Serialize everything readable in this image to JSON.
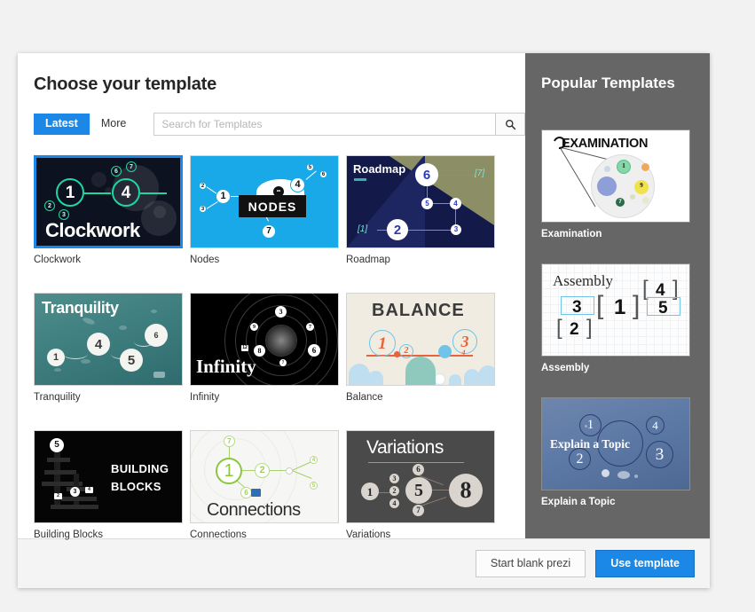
{
  "dialog": {
    "title": "Choose your template"
  },
  "filters": {
    "tabs": [
      {
        "label": "Latest",
        "active": true
      },
      {
        "label": "More",
        "active": false
      }
    ],
    "search": {
      "value": "",
      "placeholder": "Search for Templates",
      "icon": "search-icon"
    }
  },
  "templates": [
    {
      "label": "Clockwork",
      "selected": true,
      "numbers": [
        "1",
        "4",
        "2",
        "3",
        "6",
        "7"
      ],
      "title_text": "Clockwork"
    },
    {
      "label": "Nodes",
      "selected": false,
      "numbers": [
        "1",
        "2",
        "3",
        "4",
        "5",
        "6",
        "7"
      ],
      "title_text": "NODES"
    },
    {
      "label": "Roadmap",
      "selected": false,
      "numbers": [
        "1",
        "2",
        "3",
        "4",
        "5",
        "6",
        "7"
      ],
      "title_text": "Roadmap"
    },
    {
      "label": "Tranquility",
      "selected": false,
      "numbers": [
        "1",
        "4",
        "5",
        "6"
      ],
      "title_text": "Tranquility"
    },
    {
      "label": "Infinity",
      "selected": false,
      "numbers": [
        "3",
        "8",
        "6",
        "7",
        "9",
        "12"
      ],
      "title_text": "Infinity"
    },
    {
      "label": "Balance",
      "selected": false,
      "numbers": [
        "1",
        "2",
        "3",
        "4"
      ],
      "title_text": "BALANCE"
    },
    {
      "label": "Building Blocks",
      "selected": false,
      "numbers": [
        "5",
        "3"
      ],
      "title_text": "BUILDING BLOCKS"
    },
    {
      "label": "Connections",
      "selected": false,
      "numbers": [
        "7",
        "1",
        "2",
        "6"
      ],
      "title_text": "Connections"
    },
    {
      "label": "Variations",
      "selected": false,
      "numbers": [
        "1",
        "2",
        "3",
        "4",
        "5",
        "6",
        "7",
        "8"
      ],
      "title_text": "Variations"
    }
  ],
  "sidebar": {
    "title": "Popular Templates",
    "templates": [
      {
        "label": "Examination",
        "title_text": "EXAMINATION",
        "numbers": [
          "1",
          "9",
          "7"
        ]
      },
      {
        "label": "Assembly",
        "title_text": "Assembly",
        "numbers": [
          "3",
          "1",
          "4",
          "5",
          "2"
        ]
      },
      {
        "label": "Explain a Topic",
        "title_text": "Explain a Topic",
        "numbers": [
          "1",
          "2",
          "3",
          "4"
        ]
      }
    ]
  },
  "footer": {
    "start_blank_label": "Start blank prezi",
    "use_template_label": "Use template"
  },
  "colors": {
    "accent": "#1b87e6",
    "sidebar_bg": "#666666",
    "page_bg": "#f2f2f2"
  }
}
